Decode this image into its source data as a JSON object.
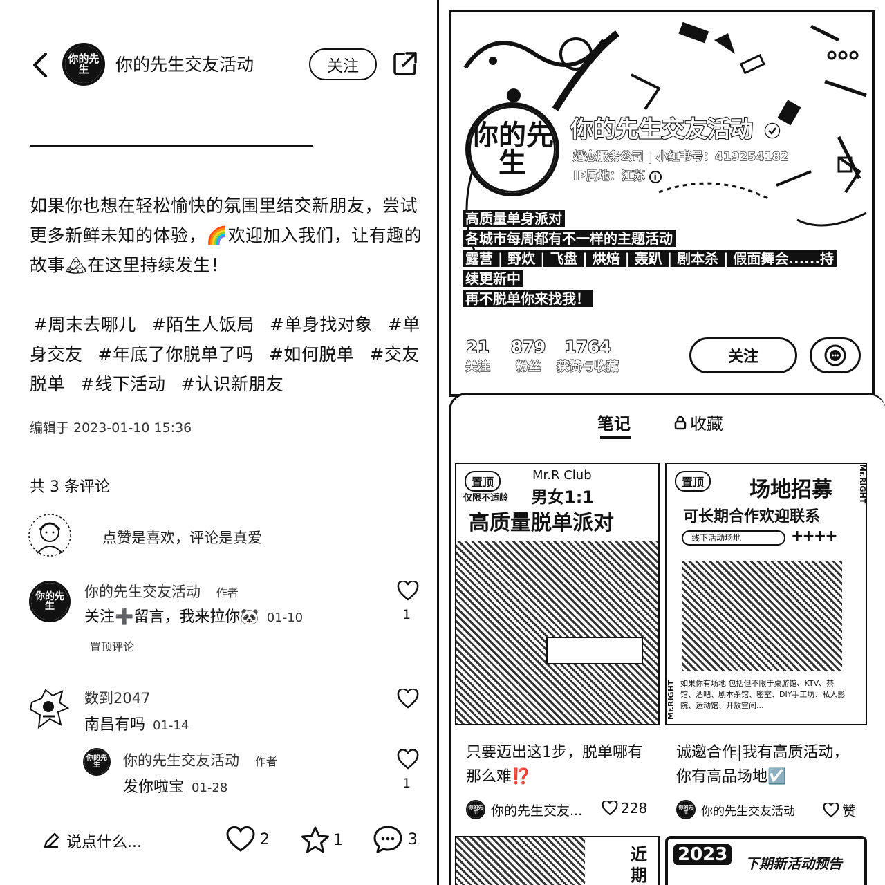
{
  "left": {
    "header": {
      "account_name": "你的先生交友活动",
      "avatar_text": "你的先生",
      "follow_label": "关注"
    },
    "post": {
      "body": "如果你也想在轻松愉快的氛围里结交新朋友，尝试更多新鲜未知的体验，🌈欢迎加入我们，让有趣的故事🏔在这里持续发生！",
      "tags": [
        "#周末去哪儿",
        "#陌生人饭局",
        "#单身找对象",
        "#单身交友",
        "#年底了你脱单了吗",
        "#如何脱单",
        "#交友脱单",
        "#线下活动",
        "#认识新朋友"
      ],
      "edited": "编辑于 2023-01-10 15:36"
    },
    "comments": {
      "count_label": "共 3 条评论",
      "prompt": "点赞是喜欢，评论是真爱",
      "items": [
        {
          "user": "你的先生交友活动",
          "author_tag": "作者",
          "text": "关注➕留言，我来拉你🐼",
          "date": "01-10",
          "likes": "1",
          "pinned": "置顶评论"
        },
        {
          "user": "数到2047",
          "text": "南昌有吗",
          "date": "01-14",
          "reply": {
            "user": "你的先生交友活动",
            "author_tag": "作者",
            "text": "发你啦宝",
            "date": "01-28",
            "likes": "1"
          }
        }
      ]
    },
    "bottom_bar": {
      "input_placeholder": "说点什么...",
      "likes": "2",
      "favorites": "1",
      "comments": "3"
    }
  },
  "right": {
    "profile": {
      "name": "你的先生交友活动",
      "avatar_text": "你的先生",
      "meta_line": "婚恋服务公司 | 小红书号：419254182",
      "ip_location": "IP属地：江苏",
      "bio_lines": [
        "高质量单身派对",
        "各城市每周都有不一样的主题活动",
        "露营 | 野炊 | 飞盘 | 烘焙 | 轰趴 | 剧本杀 | 假面舞会......持",
        "续更新中",
        "再不脱单你来找我！"
      ],
      "stats": [
        {
          "value": "21",
          "label": "关注"
        },
        {
          "value": "879",
          "label": "粉丝"
        },
        {
          "value": "1764",
          "label": "获赞与收藏"
        }
      ],
      "follow_label": "关注"
    },
    "tabs": [
      {
        "label": "笔记"
      },
      {
        "label": "收藏"
      }
    ],
    "notes": [
      {
        "pin": "置顶",
        "club": "Mr.R Club",
        "headline_small": "男女1:1",
        "sub_small": "仅限不适龄",
        "cover_title": "高质量脱单派对",
        "title": "只要迈出这1步，脱单哪有那么难⁉️",
        "author": "你的先生交友...",
        "likes": "228"
      },
      {
        "pin": "置顶",
        "cover_title": "场地招募",
        "cover_subtitle": "可长期合作欢迎联系",
        "search_text": "线下活动场地",
        "side_text": "Mr.RIGHT",
        "info_text": "如果你有场地 包括但不限于桌游馆、KTV、茶馆、酒吧、剧本杀馆、密室、DIY手工坊、私人影院、运动馆、开放空间...",
        "title": "诚邀合作|我有高质活动，你有高品场地☑️",
        "author": "你的先生交友活动",
        "likes": "赞"
      }
    ],
    "next_notes": {
      "left_text": "近期",
      "right_year": "2023",
      "right_text": "下期新活动预告"
    }
  }
}
